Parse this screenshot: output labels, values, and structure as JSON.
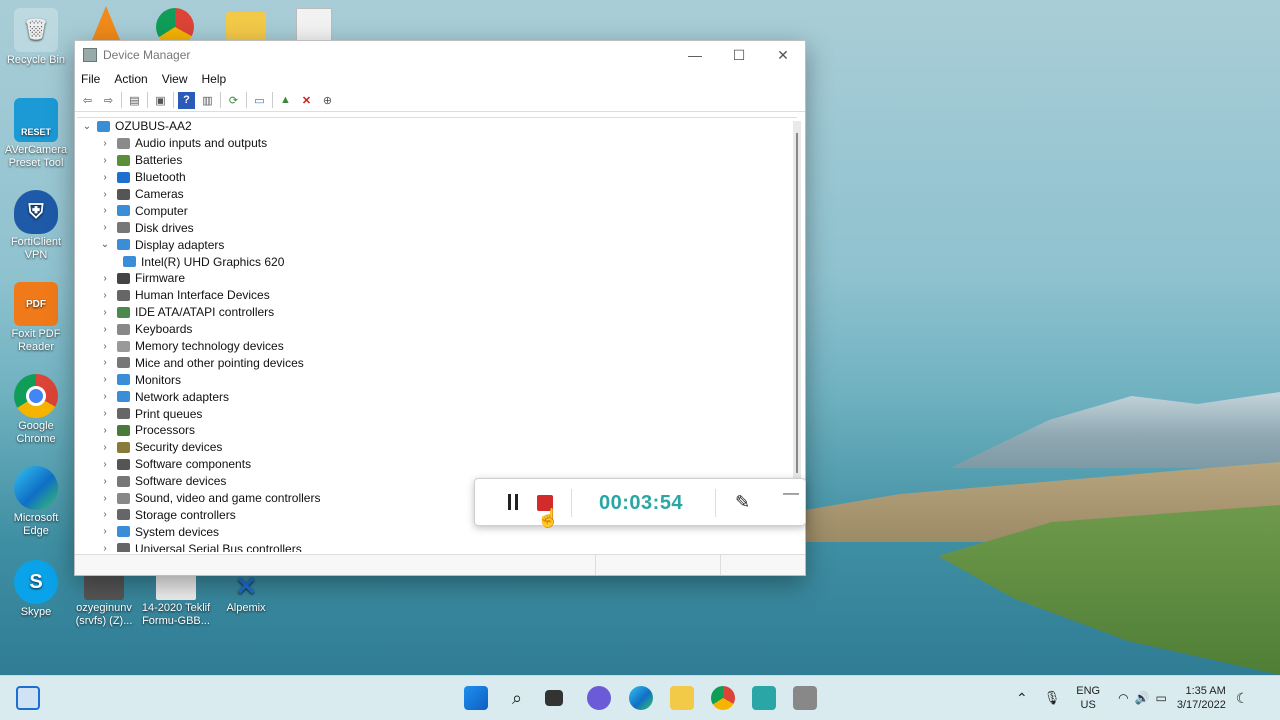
{
  "desktop_icons": [
    {
      "label": "Recycle Bin"
    },
    {
      "label": "AVerCamera Preset Tool",
      "badge": "RESET"
    },
    {
      "label": "FortiClient VPN"
    },
    {
      "label": "Foxit PDF Reader",
      "badge": "PDF"
    },
    {
      "label": "Google Chrome"
    },
    {
      "label": "Microsoft Edge"
    },
    {
      "label": "Skype",
      "glyph": "S"
    },
    {
      "label": "ozyeginunv (srvfs) (Z)..."
    },
    {
      "label": "14-2020 Teklif Formu-GBB..."
    },
    {
      "label": "Alpemix"
    }
  ],
  "window": {
    "title": "Device Manager",
    "controls": {
      "minimize": "—",
      "maximize": "☐",
      "close": "✕"
    },
    "menu": [
      "File",
      "Action",
      "View",
      "Help"
    ]
  },
  "tree": {
    "root": "OZUBUS-AA2",
    "items": [
      {
        "label": "Audio inputs and outputs",
        "color": "#8a8a8a"
      },
      {
        "label": "Batteries",
        "color": "#5a8f3a"
      },
      {
        "label": "Bluetooth",
        "color": "#1e6fd0"
      },
      {
        "label": "Cameras",
        "color": "#555555"
      },
      {
        "label": "Computer",
        "color": "#3a8ed8"
      },
      {
        "label": "Disk drives",
        "color": "#777777"
      },
      {
        "label": "Display adapters",
        "color": "#3a8ed8",
        "expanded": true
      },
      {
        "label": "Intel(R) UHD Graphics 620",
        "color": "#3a8ed8",
        "child": true
      },
      {
        "label": "Firmware",
        "color": "#444444"
      },
      {
        "label": "Human Interface Devices",
        "color": "#666666"
      },
      {
        "label": "IDE ATA/ATAPI controllers",
        "color": "#4a8a4a"
      },
      {
        "label": "Keyboards",
        "color": "#888888"
      },
      {
        "label": "Memory technology devices",
        "color": "#999999"
      },
      {
        "label": "Mice and other pointing devices",
        "color": "#777777"
      },
      {
        "label": "Monitors",
        "color": "#3a8ed8"
      },
      {
        "label": "Network adapters",
        "color": "#3a8ed8"
      },
      {
        "label": "Print queues",
        "color": "#666666"
      },
      {
        "label": "Processors",
        "color": "#4a7a3a"
      },
      {
        "label": "Security devices",
        "color": "#8a7a3a"
      },
      {
        "label": "Software components",
        "color": "#555555"
      },
      {
        "label": "Software devices",
        "color": "#777777"
      },
      {
        "label": "Sound, video and game controllers",
        "color": "#888888"
      },
      {
        "label": "Storage controllers",
        "color": "#666666"
      },
      {
        "label": "System devices",
        "color": "#3a8ed8"
      },
      {
        "label": "Universal Serial Bus controllers",
        "color": "#666666"
      }
    ]
  },
  "recorder": {
    "time": "00:03:54"
  },
  "taskbar": {
    "tray": {
      "lang_line1": "ENG",
      "lang_line2": "US",
      "time": "1:35 AM",
      "date": "3/17/2022"
    }
  }
}
